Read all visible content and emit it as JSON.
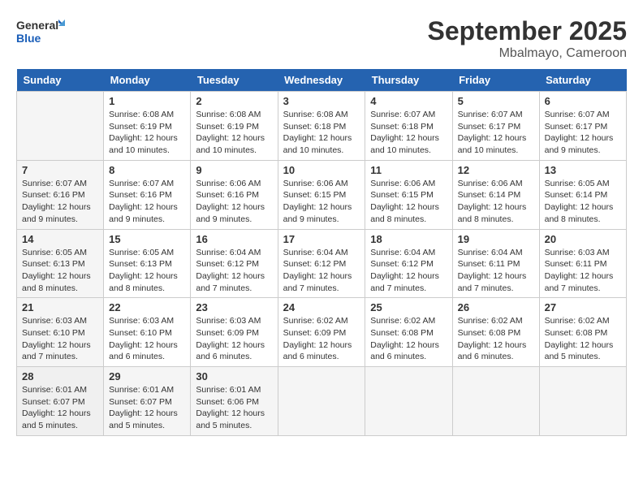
{
  "header": {
    "logo_line1": "General",
    "logo_line2": "Blue",
    "month": "September 2025",
    "location": "Mbalmayo, Cameroon"
  },
  "days_of_week": [
    "Sunday",
    "Monday",
    "Tuesday",
    "Wednesday",
    "Thursday",
    "Friday",
    "Saturday"
  ],
  "weeks": [
    [
      {
        "num": "",
        "info": ""
      },
      {
        "num": "1",
        "info": "Sunrise: 6:08 AM\nSunset: 6:19 PM\nDaylight: 12 hours\nand 10 minutes."
      },
      {
        "num": "2",
        "info": "Sunrise: 6:08 AM\nSunset: 6:19 PM\nDaylight: 12 hours\nand 10 minutes."
      },
      {
        "num": "3",
        "info": "Sunrise: 6:08 AM\nSunset: 6:18 PM\nDaylight: 12 hours\nand 10 minutes."
      },
      {
        "num": "4",
        "info": "Sunrise: 6:07 AM\nSunset: 6:18 PM\nDaylight: 12 hours\nand 10 minutes."
      },
      {
        "num": "5",
        "info": "Sunrise: 6:07 AM\nSunset: 6:17 PM\nDaylight: 12 hours\nand 10 minutes."
      },
      {
        "num": "6",
        "info": "Sunrise: 6:07 AM\nSunset: 6:17 PM\nDaylight: 12 hours\nand 9 minutes."
      }
    ],
    [
      {
        "num": "7",
        "info": "Sunrise: 6:07 AM\nSunset: 6:16 PM\nDaylight: 12 hours\nand 9 minutes."
      },
      {
        "num": "8",
        "info": "Sunrise: 6:07 AM\nSunset: 6:16 PM\nDaylight: 12 hours\nand 9 minutes."
      },
      {
        "num": "9",
        "info": "Sunrise: 6:06 AM\nSunset: 6:16 PM\nDaylight: 12 hours\nand 9 minutes."
      },
      {
        "num": "10",
        "info": "Sunrise: 6:06 AM\nSunset: 6:15 PM\nDaylight: 12 hours\nand 9 minutes."
      },
      {
        "num": "11",
        "info": "Sunrise: 6:06 AM\nSunset: 6:15 PM\nDaylight: 12 hours\nand 8 minutes."
      },
      {
        "num": "12",
        "info": "Sunrise: 6:06 AM\nSunset: 6:14 PM\nDaylight: 12 hours\nand 8 minutes."
      },
      {
        "num": "13",
        "info": "Sunrise: 6:05 AM\nSunset: 6:14 PM\nDaylight: 12 hours\nand 8 minutes."
      }
    ],
    [
      {
        "num": "14",
        "info": "Sunrise: 6:05 AM\nSunset: 6:13 PM\nDaylight: 12 hours\nand 8 minutes."
      },
      {
        "num": "15",
        "info": "Sunrise: 6:05 AM\nSunset: 6:13 PM\nDaylight: 12 hours\nand 8 minutes."
      },
      {
        "num": "16",
        "info": "Sunrise: 6:04 AM\nSunset: 6:12 PM\nDaylight: 12 hours\nand 7 minutes."
      },
      {
        "num": "17",
        "info": "Sunrise: 6:04 AM\nSunset: 6:12 PM\nDaylight: 12 hours\nand 7 minutes."
      },
      {
        "num": "18",
        "info": "Sunrise: 6:04 AM\nSunset: 6:12 PM\nDaylight: 12 hours\nand 7 minutes."
      },
      {
        "num": "19",
        "info": "Sunrise: 6:04 AM\nSunset: 6:11 PM\nDaylight: 12 hours\nand 7 minutes."
      },
      {
        "num": "20",
        "info": "Sunrise: 6:03 AM\nSunset: 6:11 PM\nDaylight: 12 hours\nand 7 minutes."
      }
    ],
    [
      {
        "num": "21",
        "info": "Sunrise: 6:03 AM\nSunset: 6:10 PM\nDaylight: 12 hours\nand 7 minutes."
      },
      {
        "num": "22",
        "info": "Sunrise: 6:03 AM\nSunset: 6:10 PM\nDaylight: 12 hours\nand 6 minutes."
      },
      {
        "num": "23",
        "info": "Sunrise: 6:03 AM\nSunset: 6:09 PM\nDaylight: 12 hours\nand 6 minutes."
      },
      {
        "num": "24",
        "info": "Sunrise: 6:02 AM\nSunset: 6:09 PM\nDaylight: 12 hours\nand 6 minutes."
      },
      {
        "num": "25",
        "info": "Sunrise: 6:02 AM\nSunset: 6:08 PM\nDaylight: 12 hours\nand 6 minutes."
      },
      {
        "num": "26",
        "info": "Sunrise: 6:02 AM\nSunset: 6:08 PM\nDaylight: 12 hours\nand 6 minutes."
      },
      {
        "num": "27",
        "info": "Sunrise: 6:02 AM\nSunset: 6:08 PM\nDaylight: 12 hours\nand 5 minutes."
      }
    ],
    [
      {
        "num": "28",
        "info": "Sunrise: 6:01 AM\nSunset: 6:07 PM\nDaylight: 12 hours\nand 5 minutes."
      },
      {
        "num": "29",
        "info": "Sunrise: 6:01 AM\nSunset: 6:07 PM\nDaylight: 12 hours\nand 5 minutes."
      },
      {
        "num": "30",
        "info": "Sunrise: 6:01 AM\nSunset: 6:06 PM\nDaylight: 12 hours\nand 5 minutes."
      },
      {
        "num": "",
        "info": ""
      },
      {
        "num": "",
        "info": ""
      },
      {
        "num": "",
        "info": ""
      },
      {
        "num": "",
        "info": ""
      }
    ]
  ]
}
